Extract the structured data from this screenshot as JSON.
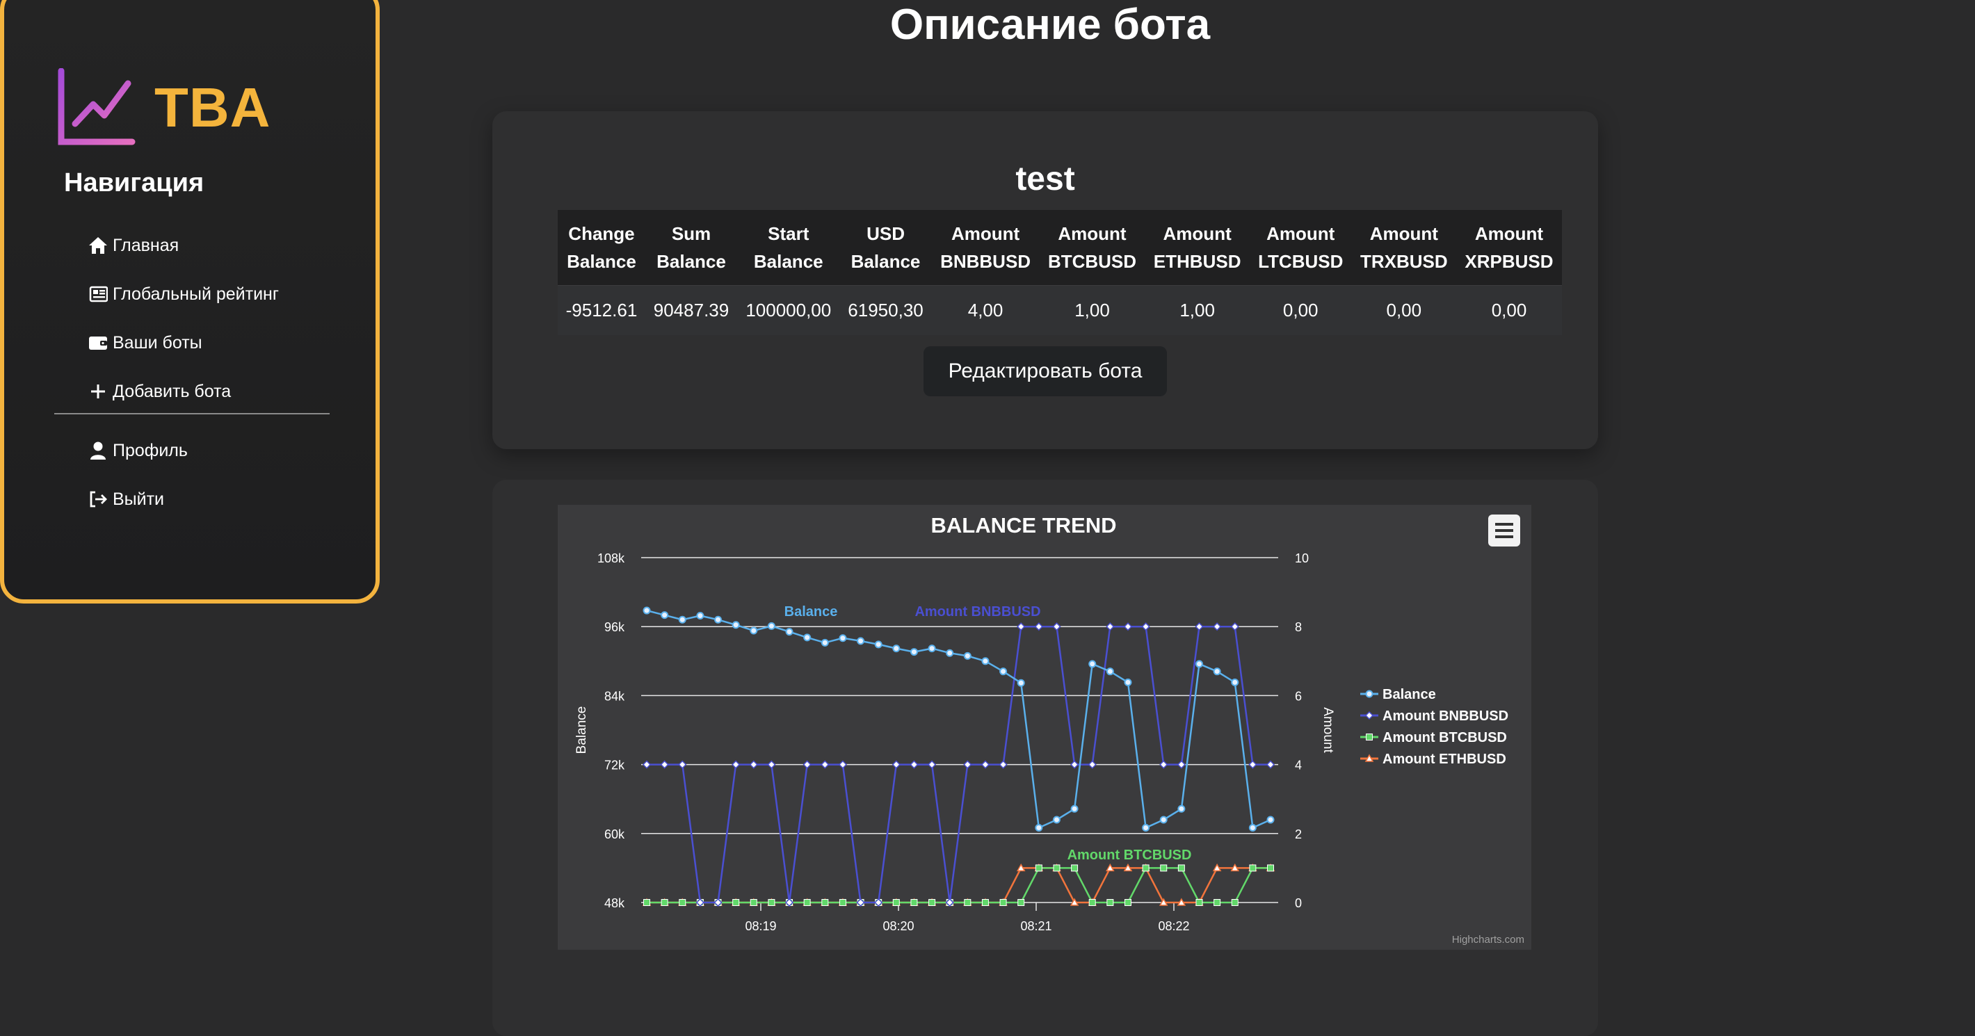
{
  "brand": {
    "name": "TBA",
    "accent": "#f4b43c"
  },
  "nav": {
    "title": "Навигация",
    "items": [
      {
        "label": "Главная",
        "icon": "home-icon"
      },
      {
        "label": "Глобальный рейтинг",
        "icon": "newspaper-icon"
      },
      {
        "label": "Ваши боты",
        "icon": "wallet-icon"
      },
      {
        "label": "Добавить бота",
        "icon": "plus-icon"
      }
    ],
    "items2": [
      {
        "label": "Профиль",
        "icon": "user-icon"
      },
      {
        "label": "Выйти",
        "icon": "logout-icon"
      }
    ]
  },
  "page": {
    "title": "Описание бота"
  },
  "bot": {
    "name": "test",
    "columns": [
      [
        "Change",
        "Balance"
      ],
      [
        "Sum",
        "Balance"
      ],
      [
        "Start",
        "Balance"
      ],
      [
        "USD",
        "Balance"
      ],
      [
        "Amount",
        "BNBBUSD"
      ],
      [
        "Amount",
        "BTCBUSD"
      ],
      [
        "Amount",
        "ETHBUSD"
      ],
      [
        "Amount",
        "LTCBUSD"
      ],
      [
        "Amount",
        "TRXBUSD"
      ],
      [
        "Amount",
        "XRPBUSD"
      ]
    ],
    "values": [
      "-9512.61",
      "90487.39",
      "100000,00",
      "61950,30",
      "4,00",
      "1,00",
      "1,00",
      "0,00",
      "0,00",
      "0,00"
    ],
    "edit_label": "Редактировать бота"
  },
  "chart_data": {
    "type": "line",
    "title": "BALANCE TREND",
    "credits": "Highcharts.com",
    "x_ticks": [
      "08:19",
      "08:20",
      "08:21",
      "08:22"
    ],
    "y_left": {
      "label": "Balance",
      "ticks": [
        "48k",
        "60k",
        "72k",
        "84k",
        "96k",
        "108k"
      ],
      "min": 48000,
      "max": 108000
    },
    "y_right": {
      "label": "Amount",
      "ticks": [
        "0",
        "2",
        "4",
        "6",
        "8",
        "10"
      ],
      "min": 0,
      "max": 10
    },
    "series": [
      {
        "name": "Balance",
        "axis": "left",
        "color": "#5ab0ec",
        "marker": "circle",
        "values": [
          98800,
          98000,
          97200,
          97900,
          97200,
          96300,
          95300,
          96100,
          95100,
          94100,
          93200,
          94000,
          93500,
          92900,
          92200,
          91600,
          92200,
          91400,
          90900,
          90000,
          88200,
          86200,
          61000,
          62400,
          64300,
          89500,
          88200,
          86300,
          61000,
          62400,
          64300,
          89500,
          88200,
          86300,
          61000,
          62400
        ]
      },
      {
        "name": "Amount BNBBUSD",
        "axis": "right",
        "color": "#4a4fd1",
        "marker": "diamond",
        "values": [
          4,
          4,
          4,
          0,
          0,
          4,
          4,
          4,
          0,
          4,
          4,
          4,
          0,
          0,
          4,
          4,
          4,
          0,
          4,
          4,
          4,
          8,
          8,
          8,
          4,
          4,
          8,
          8,
          8,
          4,
          4,
          8,
          8,
          8,
          4,
          4
        ]
      },
      {
        "name": "Amount BTCBUSD",
        "axis": "right",
        "color": "#62d86a",
        "marker": "square",
        "values": [
          0,
          0,
          0,
          0,
          0,
          0,
          0,
          0,
          0,
          0,
          0,
          0,
          0,
          0,
          0,
          0,
          0,
          0,
          0,
          0,
          0,
          0,
          1,
          1,
          1,
          0,
          0,
          0,
          1,
          1,
          1,
          0,
          0,
          0,
          1,
          1
        ]
      },
      {
        "name": "Amount ETHBUSD",
        "axis": "right",
        "color": "#f2743c",
        "marker": "triangle",
        "values": [
          0,
          0,
          0,
          0,
          0,
          0,
          0,
          0,
          0,
          0,
          0,
          0,
          0,
          0,
          0,
          0,
          0,
          0,
          0,
          0,
          0,
          1,
          1,
          1,
          0,
          0,
          1,
          1,
          1,
          0,
          0,
          0,
          1,
          1,
          1,
          1
        ]
      }
    ],
    "labels": [
      "Balance",
      "Amount BNBBUSD",
      "Amount BTCBUSD"
    ],
    "legend_position": "right"
  }
}
